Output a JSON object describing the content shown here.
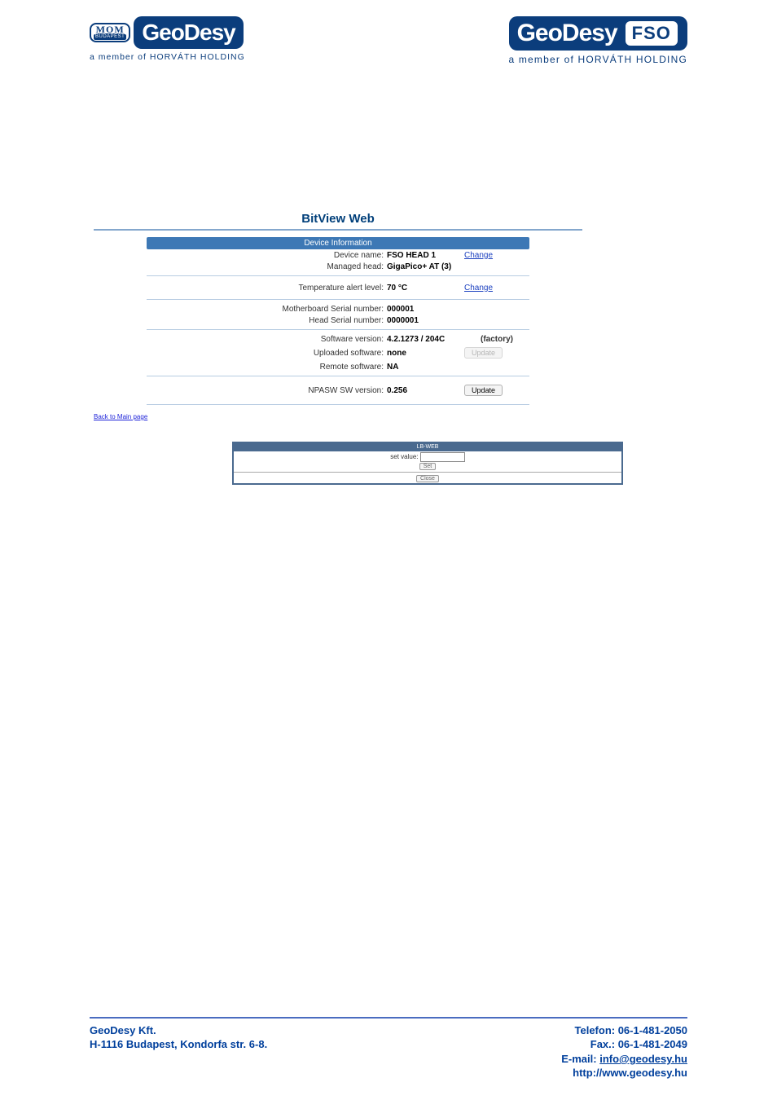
{
  "header": {
    "logo_left_badge_top": "MOM",
    "logo_left_badge_bot": "BUDAPEST",
    "logo_left_main": "GeoDesy",
    "logo_left_tagline": "a member of HORVÁTH HOLDING",
    "logo_right_main": "GeoDesy",
    "logo_right_pill": "FSO",
    "logo_right_tagline": "a member of HORVÁTH HOLDING"
  },
  "bitview": {
    "title": "BitView Web",
    "panel_header": "Device Information",
    "labels": {
      "device_name": "Device name:",
      "managed_head": "Managed head:",
      "temp_alert": "Temperature alert level:",
      "mb_serial": "Motherboard Serial number:",
      "head_serial": "Head Serial number:",
      "sw_version": "Software version:",
      "uploaded_sw": "Uploaded software:",
      "remote_sw": "Remote software:",
      "npasw": "NPASW SW version:"
    },
    "values": {
      "device_name": "FSO HEAD 1",
      "managed_head": "GigaPico+ AT (3)",
      "temp_alert": "70 °C",
      "mb_serial": "000001",
      "head_serial": "0000001",
      "sw_version": "4.2.1273 / 204C",
      "uploaded_sw": "none",
      "remote_sw": "NA",
      "npasw": "0.256"
    },
    "actions": {
      "change": "Change",
      "factory": "(factory)",
      "update": "Update"
    },
    "back": "Back to Main page"
  },
  "lbweb": {
    "header": "LB-WEB",
    "set_label": "set value:",
    "set_btn": "Set",
    "close_btn": "Close"
  },
  "footer": {
    "company": "GeoDesy Kft.",
    "address": "H-1116 Budapest, Kondorfa str. 6-8.",
    "phone": "Telefon: 06-1-481-2050",
    "fax": "Fax.: 06-1-481-2049",
    "email_label": "E-mail: ",
    "email": "info@geodesy.hu",
    "web": "http://www.geodesy.hu"
  }
}
